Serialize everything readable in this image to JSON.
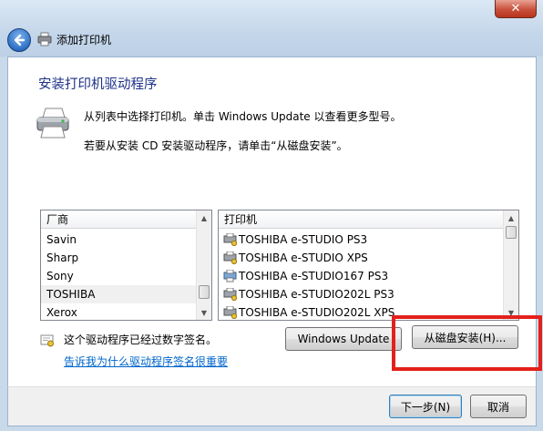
{
  "window": {
    "title": "添加打印机",
    "close_glyph": "✕"
  },
  "heading": "安装打印机驱动程序",
  "instructions": {
    "line1": "从列表中选择打印机。单击 Windows Update 以查看更多型号。",
    "line2": "若要从安装 CD 安装驱动程序，请单击“从磁盘安装”。"
  },
  "manufacturer_list": {
    "header": "厂商",
    "items": [
      "Savin",
      "Sharp",
      "Sony",
      "TOSHIBA",
      "Xerox"
    ],
    "selected": "TOSHIBA"
  },
  "printer_list": {
    "header": "打印机",
    "items": [
      "TOSHIBA e-STUDIO PS3",
      "TOSHIBA e-STUDIO XPS",
      "TOSHIBA e-STUDIO167 PS3",
      "TOSHIBA e-STUDIO202L PS3",
      "TOSHIBA e-STUDIO202L XPS"
    ]
  },
  "signature": {
    "text": "这个驱动程序已经过数字签名。",
    "link": "告诉我为什么驱动程序签名很重要"
  },
  "buttons": {
    "windows_update": "Windows Update",
    "have_disk": "从磁盘安装(H)...",
    "next": "下一步(N)",
    "cancel": "取消"
  },
  "icons": {
    "back": "back-arrow-icon",
    "printer": "printer-icon",
    "certificate": "certificate-icon"
  },
  "colors": {
    "heading": "#1e3287",
    "link": "#0066cc",
    "highlight_box": "#e3201b"
  }
}
